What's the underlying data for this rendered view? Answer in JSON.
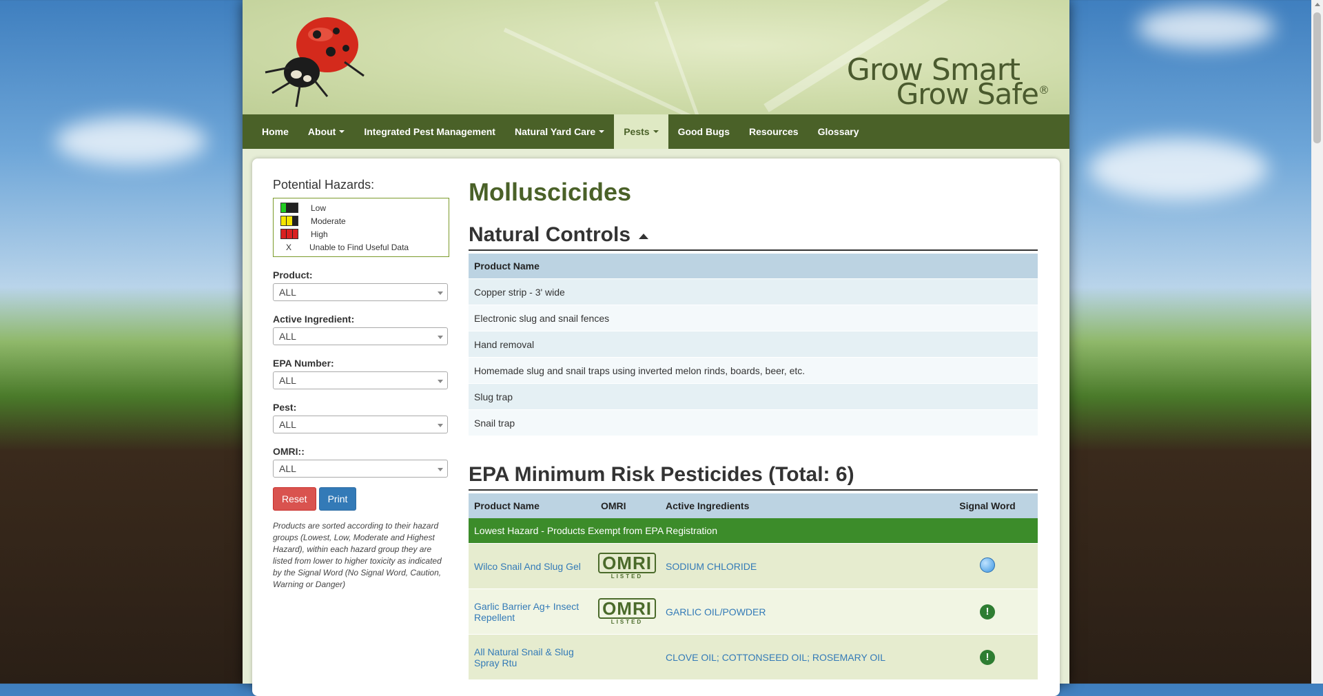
{
  "brand": {
    "line1": "Grow Smart",
    "line2": "Grow Safe",
    "reg": "®"
  },
  "colors": {
    "nav": "#4a6128",
    "accent": "#4a6128",
    "group": "#3c8c2a",
    "reset": "#d9534f",
    "print": "#337ab7",
    "hazard_low": "#22cc22",
    "hazard_moderate": "#f5e500",
    "hazard_high": "#d92020"
  },
  "nav": {
    "items": [
      {
        "label": "Home"
      },
      {
        "label": "About"
      },
      {
        "label": "Integrated Pest Management"
      },
      {
        "label": "Natural Yard Care"
      },
      {
        "label": "Pests"
      },
      {
        "label": "Good Bugs"
      },
      {
        "label": "Resources"
      },
      {
        "label": "Glossary"
      }
    ]
  },
  "sidebar": {
    "title": "Potential Hazards:",
    "legend": {
      "low": "Low",
      "moderate": "Moderate",
      "high": "High",
      "x_mark": "X",
      "unknown": "Unable to Find Useful Data"
    },
    "filters": {
      "product": {
        "label": "Product:",
        "value": "ALL"
      },
      "ingredient": {
        "label": "Active Ingredient:",
        "value": "ALL"
      },
      "epa": {
        "label": "EPA Number:",
        "value": "ALL"
      },
      "pest": {
        "label": "Pest:",
        "value": "ALL"
      },
      "omri": {
        "label": "OMRI::",
        "value": "ALL"
      }
    },
    "reset_label": "Reset",
    "print_label": "Print",
    "note": "Products are sorted according to their hazard groups (Lowest, Low, Moderate and Highest Hazard), within each hazard group they are listed from lower to higher toxicity as indicated by the Signal Word (No Signal Word, Caution, Warning or Danger)"
  },
  "main": {
    "title": "Molluscicides",
    "natural": {
      "heading": "Natural Controls",
      "column": "Product Name",
      "rows": [
        "Copper strip - 3' wide",
        "Electronic slug and snail fences",
        "Hand removal",
        "Homemade slug and snail traps using inverted melon rinds, boards, beer, etc.",
        "Slug trap",
        "Snail trap"
      ]
    },
    "epa": {
      "heading": "EPA Minimum Risk Pesticides (Total: 6)",
      "columns": {
        "product": "Product Name",
        "omri": "OMRI",
        "ingredients": "Active Ingredients",
        "signal": "Signal Word"
      },
      "group": "Lowest Hazard - Products Exempt from EPA Registration",
      "omri_logo": {
        "top": "OMRI",
        "sub": "LISTED"
      },
      "signal_symbol": "!",
      "rows": [
        {
          "name": "Wilco Snail And Slug Gel",
          "ingredients": "SODIUM CHLORIDE"
        },
        {
          "name": "Garlic Barrier Ag+ Insect Repellent",
          "ingredients": "GARLIC OIL/POWDER"
        },
        {
          "name": "All Natural Snail & Slug Spray Rtu",
          "ingredients": "CLOVE OIL; COTTONSEED OIL; ROSEMARY OIL"
        }
      ]
    }
  }
}
